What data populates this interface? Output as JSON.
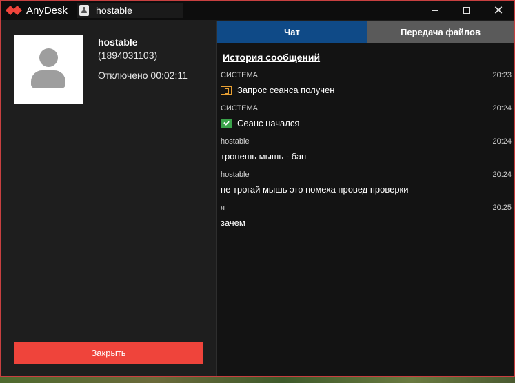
{
  "titlebar": {
    "app_name": "AnyDesk",
    "tab_label": "hostable"
  },
  "peer": {
    "name": "hostable",
    "id": "(1894031103)",
    "status": "Отключено 00:02:11"
  },
  "close_button_label": "Закрыть",
  "tabs": {
    "chat": "Чат",
    "files": "Передача файлов"
  },
  "history_title": "История сообщений",
  "messages": [
    {
      "sender": "СИСТЕМА",
      "time": "20:23",
      "text": "Запрос сеанса получен",
      "icon": "session-request-icon"
    },
    {
      "sender": "СИСТЕМА",
      "time": "20:24",
      "text": "Сеанс начался",
      "icon": "session-started-icon"
    },
    {
      "sender": "hostable",
      "time": "20:24",
      "text": "тронешь мышь - бан"
    },
    {
      "sender": "hostable",
      "time": "20:24",
      "text": "не трогай мышь это помеха провед проверки"
    },
    {
      "sender": "я",
      "time": "20:25",
      "text": "зачем"
    }
  ],
  "colors": {
    "accent": "#ef443b",
    "active_tab": "#0f4a87",
    "inactive_tab": "#5a5a5a"
  }
}
